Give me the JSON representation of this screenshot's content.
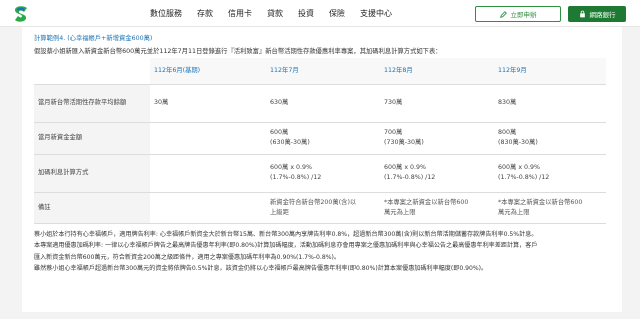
{
  "header": {
    "nav": [
      "數位服務",
      "存款",
      "信用卡",
      "貸款",
      "投資",
      "保險",
      "支援中心"
    ],
    "register_label": "立即申辦",
    "login_label": "網路銀行",
    "accent_color": "#1e7a32"
  },
  "content": {
    "example_title": "計算範例4. (心幸福帳戶+新增資金600萬)",
    "intro": "假設蔡小姐新匯入新資金新台幣600萬元並於112年7月11日登錄進行『活利致富』新台幣活期性存款優惠利率專案，其加碼利息計算方式如下表：",
    "table": {
      "headers": [
        "",
        "112年6月(基期)",
        "112年7月",
        "112年8月",
        "112年9月"
      ],
      "rows": [
        {
          "label": "當月新台幣活期性存款平均餘額",
          "cells": [
            [
              "30萬"
            ],
            [
              "630萬"
            ],
            [
              "730萬"
            ],
            [
              "830萬"
            ]
          ]
        },
        {
          "label": "當月新資金金額",
          "cells": [
            [
              ""
            ],
            [
              "600萬",
              "(630萬-30萬)"
            ],
            [
              "700萬",
              "(730萬-30萬)"
            ],
            [
              "800萬",
              "(830萬-30萬)"
            ]
          ]
        },
        {
          "label": "加碼利息計算方式",
          "cells": [
            [
              ""
            ],
            [
              "600萬 x 0.9%",
              "(1.7%-0.8%) /12"
            ],
            [
              "600萬 x 0.9%",
              "(1.7%-0.8%) /12"
            ],
            [
              "600萬 x 0.9%",
              "(1.7%-0.8%) /12"
            ]
          ]
        },
        {
          "label": "備註",
          "cells": [
            [
              ""
            ],
            [
              "新資金符合新台幣200萬(含)以",
              "上級距"
            ],
            [
              "*本專案之新資金以新台幣600",
              "萬元為上限"
            ],
            [
              "*本專案之新資金以新台幣600",
              "萬元為上限"
            ]
          ]
        }
      ]
    },
    "footnotes": [
      "蔡小姐於本行持有心幸福帳戶，適用牌告利率: 心幸福帳戶新資金大於新台幣15萬、新台幣300萬內享牌告利率0.8%，超過新台幣300萬(含)則以新台幣活期儲蓄存款牌告利率0.5%計息。",
      "本專案適用優惠加碼利率: 一律以心幸福帳戶牌告之最高牌告優惠年利率(即0.80%)計算加碼幅度，活動加碼利息亦會用專案之優惠加碼利率與心幸福公告之最高優惠年利率差距計算，客戶",
      "匯入新資金新台幣600萬元，符合新資金200萬之級距條件，適用之專案優惠加碼年利率為0.90%(1.7%-0.8%)。",
      "雖然蔡小姐心幸福帳戶超過新台幣300萬元的資金將依牌告0.5%計息，該資金仍將以心幸福帳戶最高牌告優惠年利率(即0.80%)計算本案優惠加碼利率幅度(即0.90%)。"
    ]
  }
}
